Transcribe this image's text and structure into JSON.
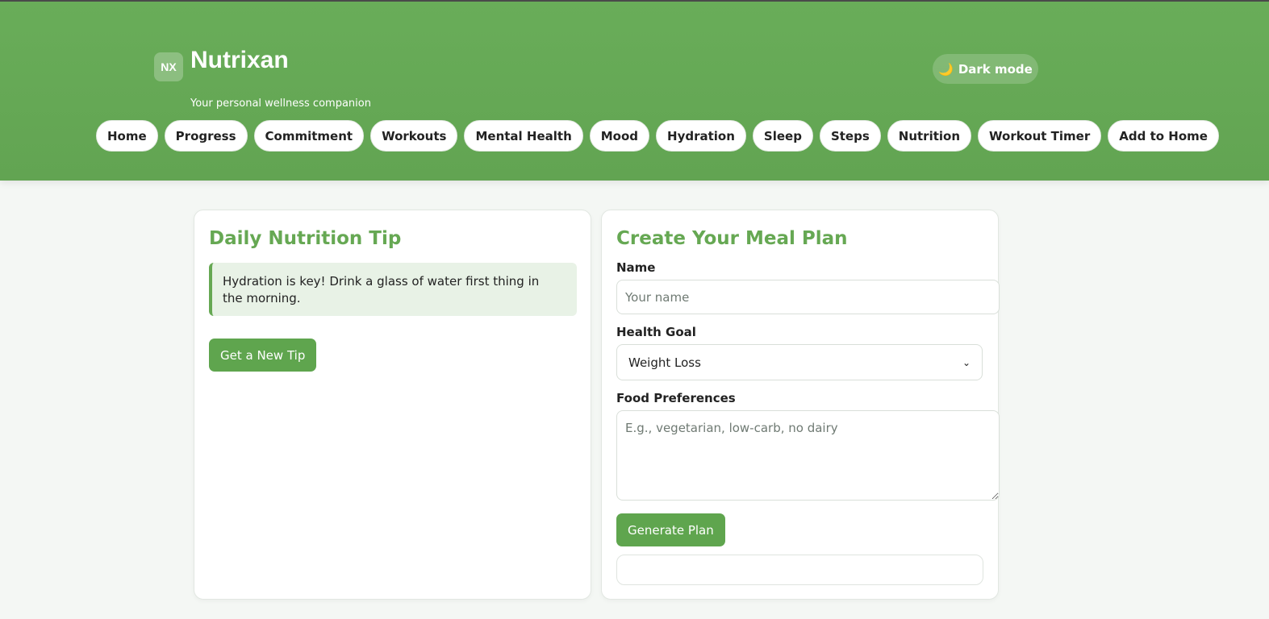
{
  "header": {
    "logo_text": "NX",
    "title": "Nutrixan",
    "tagline": "Your personal wellness companion",
    "dark_mode_label": "Dark mode",
    "dark_mode_icon": "moon-icon"
  },
  "nav": {
    "items": [
      {
        "label": "Home"
      },
      {
        "label": "Progress"
      },
      {
        "label": "Commitment"
      },
      {
        "label": "Workouts"
      },
      {
        "label": "Mental Health"
      },
      {
        "label": "Mood"
      },
      {
        "label": "Hydration"
      },
      {
        "label": "Sleep"
      },
      {
        "label": "Steps"
      },
      {
        "label": "Nutrition"
      },
      {
        "label": "Workout Timer"
      },
      {
        "label": "Add to Home"
      }
    ]
  },
  "tip_card": {
    "title": "Daily Nutrition Tip",
    "tip_text": "Hydration is key! Drink a glass of water first thing in the morning.",
    "button_label": "Get a New Tip"
  },
  "meal_plan": {
    "title": "Create Your Meal Plan",
    "name_label": "Name",
    "name_placeholder": "Your name",
    "name_value": "",
    "goal_label": "Health Goal",
    "goal_selected": "Weight Loss",
    "preferences_label": "Food Preferences",
    "preferences_placeholder": "E.g., vegetarian, low-carb, no dairy",
    "preferences_value": "",
    "button_label": "Generate Plan",
    "result_text": ""
  },
  "colors": {
    "header_green": "#66a853",
    "accent_green": "#5fa54e",
    "tip_background": "#e8f2e6",
    "page_background": "#f4f7f4"
  }
}
